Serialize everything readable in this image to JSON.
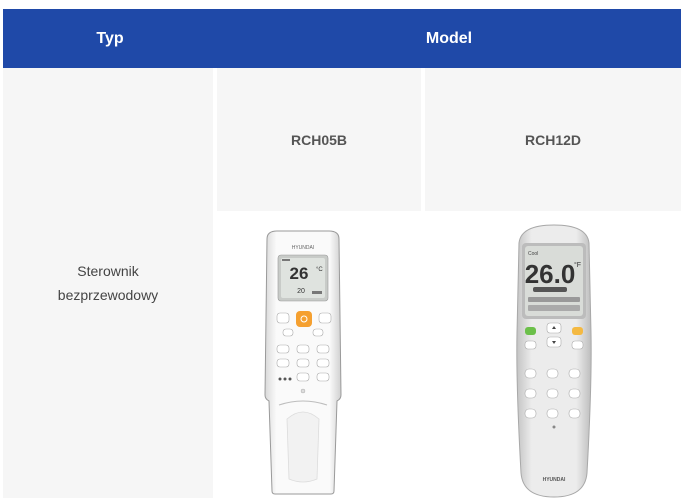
{
  "table": {
    "header": {
      "col_type": "Typ",
      "col_model": "Model"
    },
    "models": [
      "RCH05B",
      "RCH12D"
    ],
    "type_label": "Sterownik bezprzewodowy"
  },
  "remote1": {
    "brand": "HYUNDAI",
    "temp": "26",
    "unit": "°C",
    "sub": "20",
    "accent": "#f5a030"
  },
  "remote2": {
    "brand": "HYUNDAI",
    "temp": "26.0",
    "unit": "°F",
    "green": "#6cc04a",
    "orange": "#f4b942"
  }
}
